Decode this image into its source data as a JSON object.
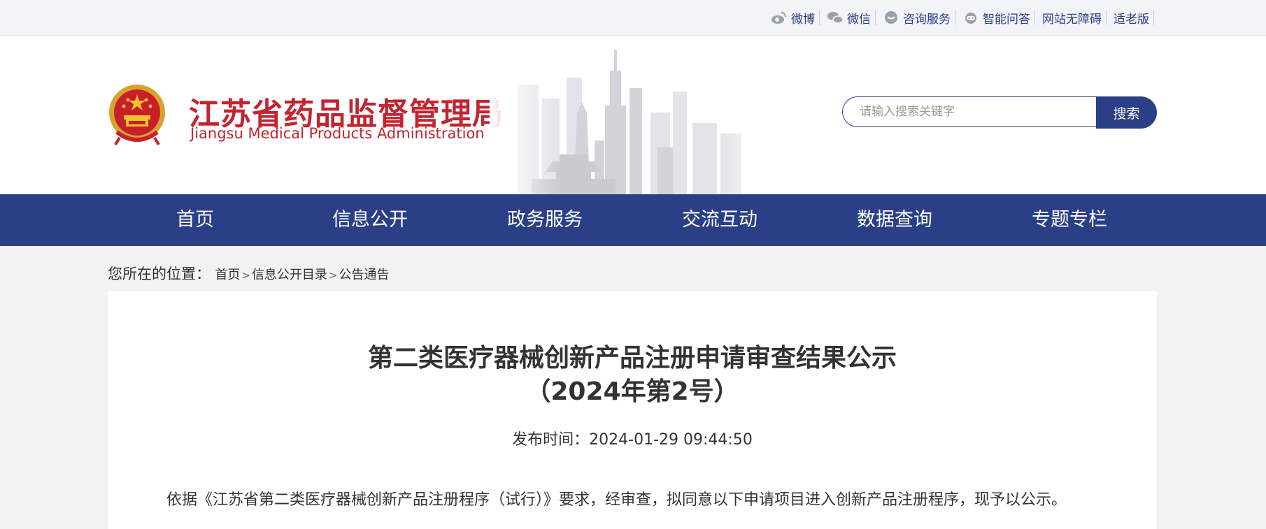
{
  "top_links": [
    {
      "label": "微博",
      "icon": "weibo-icon"
    },
    {
      "label": "微信",
      "icon": "wechat-icon"
    },
    {
      "label": "咨询服务",
      "icon": "consult-icon"
    },
    {
      "label": "智能问答",
      "icon": "robot-icon"
    },
    {
      "label": "网站无障碍",
      "icon": ""
    },
    {
      "label": "适老版",
      "icon": ""
    }
  ],
  "header": {
    "title": "江苏省药品监督管理局",
    "subtitle": "Jiangsu Medical Products Administration",
    "brand_color": "#c3242f"
  },
  "search": {
    "placeholder": "请输入搜索关键字",
    "button": "搜索"
  },
  "nav": [
    "首页",
    "信息公开",
    "政务服务",
    "交流互动",
    "数据查询",
    "专题专栏"
  ],
  "breadcrumb": {
    "label": "您所在的位置：",
    "items": [
      "首页",
      "信息公开目录",
      "公告通告"
    ],
    "separator": ">"
  },
  "article": {
    "title_line1": "第二类医疗器械创新产品注册申请审查结果公示",
    "title_line2": "（2024年第2号）",
    "publish_label": "发布时间：",
    "publish_time": "2024-01-29 09:44:50",
    "body": "依据《江苏省第二类医疗器械创新产品注册程序（试行）》要求，经审查，拟同意以下申请项目进入创新产品注册程序，现予以公示。"
  },
  "colors": {
    "primary": "#2b3f86",
    "background": "#f2f2f2"
  }
}
